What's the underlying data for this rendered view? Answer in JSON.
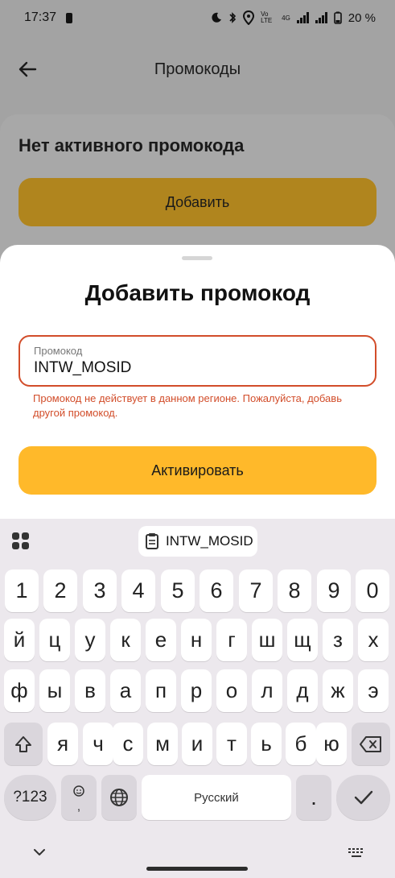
{
  "status": {
    "time": "17:37",
    "battery": "20 %",
    "volte": "Vo LTE",
    "network": "4G"
  },
  "header": {
    "title": "Промокоды"
  },
  "card": {
    "title": "Нет активного промокода",
    "add_label": "Добавить"
  },
  "sheet": {
    "title": "Добавить промокод",
    "field_label": "Промокод",
    "field_value": "INTW_MOSID",
    "error": "Промокод не действует в данном регионе. Пожалуйста, добавь другой промокод.",
    "activate_label": "Активировать"
  },
  "keyboard": {
    "clipboard": "INTW_MOSID",
    "row_numbers": [
      "1",
      "2",
      "3",
      "4",
      "5",
      "6",
      "7",
      "8",
      "9",
      "0"
    ],
    "row1": [
      "й",
      "ц",
      "у",
      "к",
      "е",
      "н",
      "г",
      "ш",
      "щ",
      "з",
      "х"
    ],
    "row2": [
      "ф",
      "ы",
      "в",
      "а",
      "п",
      "р",
      "о",
      "л",
      "д",
      "ж",
      "э"
    ],
    "row3": [
      "я",
      "ч",
      "с",
      "м",
      "и",
      "т",
      "ь",
      "б",
      "ю"
    ],
    "symbols_label": "?123",
    "space_label": "Русский",
    "period_label": "."
  },
  "colors": {
    "accent": "#ffb92a",
    "error": "#d24d2a",
    "dim_accent": "#b0851e"
  },
  "icons": [
    "back-arrow-icon",
    "shift-icon",
    "backspace-icon",
    "emoji-icon",
    "globe-icon",
    "check-icon",
    "clipboard-icon",
    "apps-grid-icon",
    "chevron-down-icon",
    "keyboard-icon"
  ]
}
